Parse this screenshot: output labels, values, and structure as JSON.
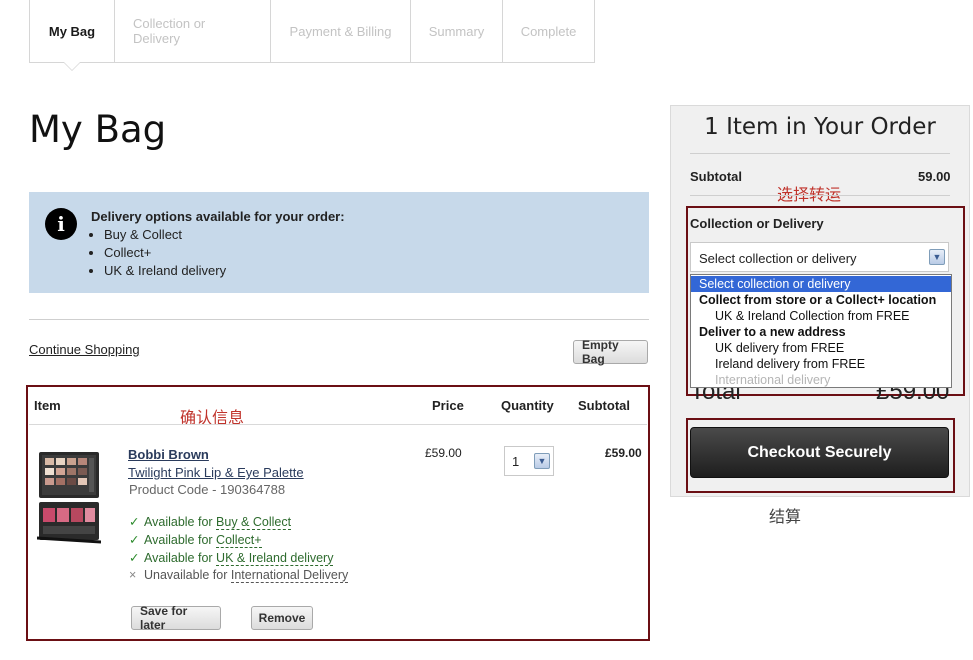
{
  "steps": [
    {
      "label": "My Bag",
      "active": true
    },
    {
      "label": "Collection or Delivery",
      "active": false
    },
    {
      "label": "Payment & Billing",
      "active": false
    },
    {
      "label": "Summary",
      "active": false
    },
    {
      "label": "Complete",
      "active": false
    }
  ],
  "page_title": "My Bag",
  "info": {
    "icon": "info-icon",
    "glyph": "i",
    "title": "Delivery options available for your order:",
    "items": [
      "Buy & Collect",
      "Collect+",
      "UK & Ireland delivery"
    ]
  },
  "continue_shopping": "Continue Shopping",
  "empty_bag": "Empty Bag",
  "table": {
    "headers": {
      "item": "Item",
      "price": "Price",
      "quantity": "Quantity",
      "subtotal": "Subtotal"
    },
    "annotation": "确认信息"
  },
  "product": {
    "brand": "Bobbi Brown",
    "name": "Twilight Pink Lip & Eye Palette",
    "code": "Product Code - 190364788",
    "price": "£59.00",
    "quantity": "1",
    "subtotal": "£59.00",
    "availability": [
      {
        "mark": "✓",
        "prefix": "Available for ",
        "option": "Buy & Collect",
        "available": true
      },
      {
        "mark": "✓",
        "prefix": "Available for ",
        "option": "Collect+",
        "available": true
      },
      {
        "mark": "✓",
        "prefix": "Available for ",
        "option": "UK & Ireland delivery",
        "available": true
      },
      {
        "mark": "×",
        "prefix": "Unavailable for ",
        "option": "International Delivery",
        "available": false
      }
    ],
    "save_for_later": "Save for later",
    "remove": "Remove"
  },
  "summary": {
    "title": "1 Item in Your Order",
    "subtotal_label": "Subtotal",
    "subtotal_value": "59.00",
    "annotation_select": "选择转运",
    "delivery_label": "Collection or Delivery",
    "delivery_selected": "Select collection or delivery",
    "options": [
      {
        "label": "Select collection or delivery",
        "kind": "highlighted"
      },
      {
        "label": "Collect from store or a Collect+ location",
        "kind": "group"
      },
      {
        "label": "UK & Ireland Collection from FREE",
        "kind": "option"
      },
      {
        "label": "Deliver to a new address",
        "kind": "group"
      },
      {
        "label": "UK delivery from FREE",
        "kind": "option"
      },
      {
        "label": "Ireland delivery from FREE",
        "kind": "option"
      },
      {
        "label": "International delivery",
        "kind": "disabled"
      }
    ],
    "total_label": "Total",
    "total_value": "£59.00",
    "checkout": "Checkout Securely",
    "annotation_checkout": "结算"
  },
  "colors": {
    "info_bg": "#c7d9ea",
    "annotation_frame": "#6b0f14",
    "annotation_text": "#c0332b",
    "dropdown_highlight": "#3367d6"
  }
}
